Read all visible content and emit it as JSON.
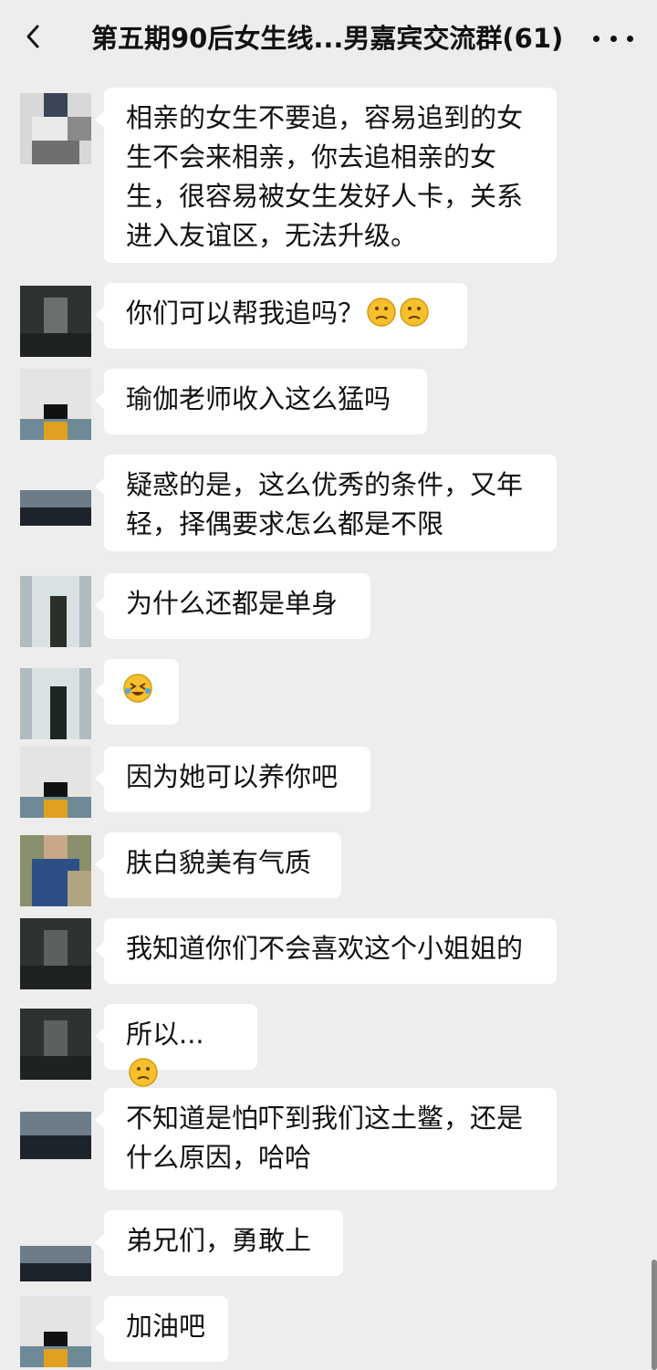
{
  "header": {
    "title": "第五期90后女生线...男嘉宾交流群(61)",
    "back_icon": "chevron-left-icon",
    "more_icon": "more-horizontal-icon"
  },
  "messages": [
    {
      "text": "相亲的女生不要追，容易追到的女生不会来相亲，你去追相亲的女生，很容易被女生发好人卡，关系进入友谊区，无法升级。"
    },
    {
      "text": "你们可以帮我追吗？",
      "emoji": [
        "thinking-face-icon",
        "thinking-face-icon"
      ]
    },
    {
      "text": "瑜伽老师收入这么猛吗"
    },
    {
      "text": "疑惑的是，这么优秀的条件，又年轻，择偶要求怎么都是不限"
    },
    {
      "text": "为什么还都是单身"
    },
    {
      "text": "",
      "emoji": [
        "laughing-crying-face-icon"
      ]
    },
    {
      "text": "因为她可以养你吧"
    },
    {
      "text": "肤白貌美有气质"
    },
    {
      "text": "我知道你们不会喜欢这个小姐姐的"
    },
    {
      "text": "所以...",
      "emoji": [
        "thinking-face-icon"
      ]
    },
    {
      "text": "不知道是怕吓到我们这土鳖，还是什么原因，哈哈"
    },
    {
      "text": "弟兄们，勇敢上"
    },
    {
      "text": "加油吧"
    }
  ],
  "colors": {
    "background": "#ededed",
    "bubble": "#ffffff",
    "text": "#111111"
  }
}
